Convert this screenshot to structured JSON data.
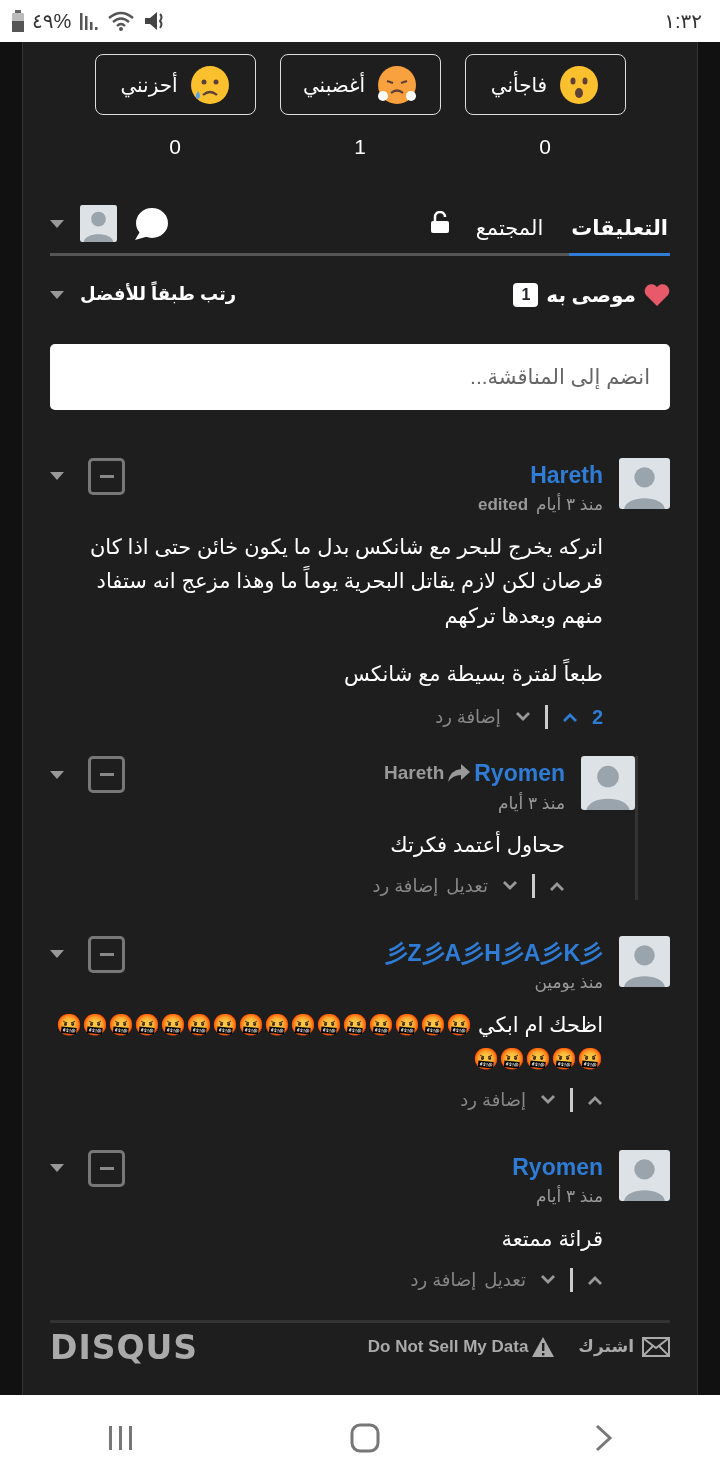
{
  "status_bar": {
    "time": "١:٣٢",
    "battery": "%٤٩"
  },
  "reactions": [
    {
      "kind": "surprised",
      "label": "فاجأني",
      "count": "0"
    },
    {
      "kind": "steam",
      "label": "أغضبني",
      "count": "1"
    },
    {
      "kind": "sad",
      "label": "أحزنني",
      "count": "0"
    }
  ],
  "tabs": [
    {
      "label": "التعليقات",
      "selected": true
    },
    {
      "label": "المجتمع",
      "selected": false
    }
  ],
  "sort": {
    "recommend_label": "موصى به",
    "recommend_count": "1",
    "sort_label": "رتب طبقاً للأفضل"
  },
  "composer": {
    "placeholder": "انضم إلى المناقشة..."
  },
  "comments": [
    {
      "author": "Hareth",
      "time": "منذ ٣ أيام",
      "edited": "edited",
      "paragraphs": [
        "اتركه يخرج للبحر مع شانكس بدل ما يكون خائن حتى اذا كان قرصان لكن لازم يقاتل البحرية يوماً ما وهذا مزعج انه ستفاد منهم وبعدها تركهم",
        "طبعاً لفترة بسيطة مع شانكس"
      ],
      "votes": "2",
      "upvoted": true,
      "actions": [
        "إضافة رد"
      ],
      "replies": [
        {
          "author": "Ryomen",
          "reply_to": "Hareth",
          "time": "منذ ٣ أيام",
          "paragraphs": [
            "ححاول أعتمد فكرتك"
          ],
          "upvoted": false,
          "actions": [
            "تعديل",
            "إضافة رد"
          ]
        }
      ]
    },
    {
      "author": "彡Z彡A彡H彡A彡K彡",
      "time": "منذ يومين",
      "paragraphs": [
        "اظحك ام ابكي 🤬🤬🤬🤬🤬🤬🤬🤬🤬🤬🤬🤬🤬🤬🤬🤬🤬🤬🤬🤬🤬"
      ],
      "upvoted": false,
      "actions": [
        "إضافة رد"
      ]
    },
    {
      "author": "Ryomen",
      "time": "منذ ٣ أيام",
      "paragraphs": [
        "قرائة ممتعة"
      ],
      "upvoted": false,
      "actions": [
        "تعديل",
        "إضافة رد"
      ]
    }
  ],
  "footer": {
    "subscribe": "اشترك",
    "do_not_sell": "Do Not Sell My Data",
    "logo": "DISQUS"
  }
}
